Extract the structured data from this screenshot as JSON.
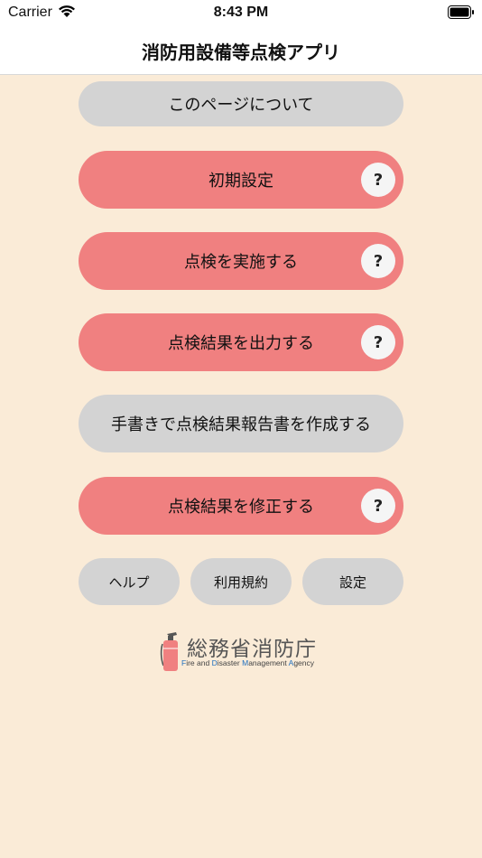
{
  "status_bar": {
    "carrier": "Carrier",
    "time": "8:43 PM"
  },
  "nav": {
    "title": "消防用設備等点検アプリ"
  },
  "menu": {
    "about": "このページについて",
    "initial_setup": "初期設定",
    "perform_inspection": "点検を実施する",
    "output_results": "点検結果を出力する",
    "handwritten_report": "手書きで点検結果報告書を作成する",
    "edit_results": "点検結果を修正する",
    "help_mark": "?"
  },
  "footer_buttons": {
    "help": "ヘルプ",
    "terms": "利用規約",
    "settings": "設定"
  },
  "logo": {
    "title": "総務省消防庁",
    "subtitle_parts": [
      "F",
      "ire and ",
      "D",
      "isaster ",
      "M",
      "anagement ",
      "A",
      "gency"
    ]
  },
  "colors": {
    "background": "#faebd7",
    "button_gray": "#d3d3d3",
    "button_red": "#f08080",
    "logo_accent": "#1e6fbf"
  }
}
